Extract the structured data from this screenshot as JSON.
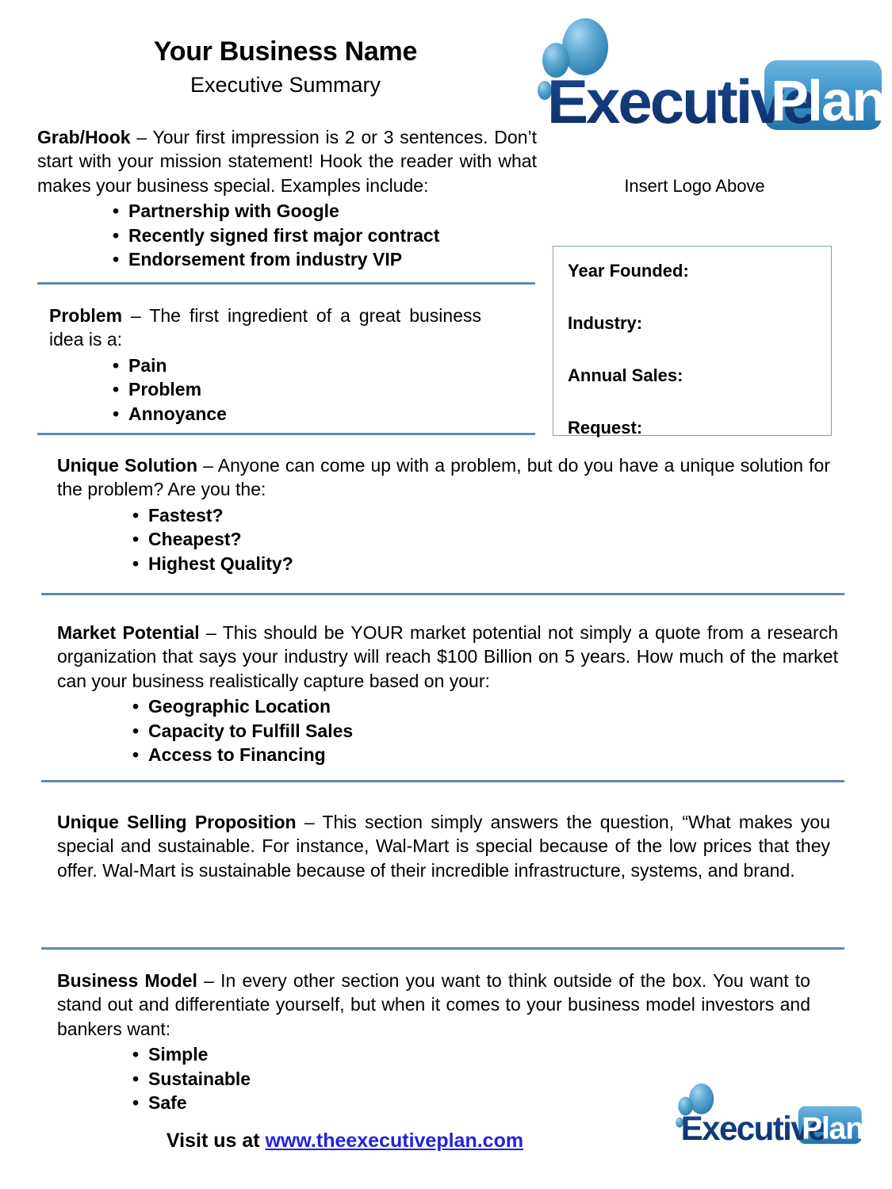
{
  "document": {
    "title": "Your Business Name",
    "subtitle": "Executive Summary"
  },
  "logo": {
    "word_dark": "Executive",
    "word_light": "Plan",
    "caption": "Insert Logo Above",
    "colors": {
      "dark_navy": "#123A7A",
      "badge_top": "#5CA8D8",
      "badge_bottom": "#2B7AB8",
      "bubble": "#479BCB"
    }
  },
  "info_box": {
    "fields": [
      "Year Founded:",
      "Industry:",
      "Annual Sales:",
      "Request:"
    ],
    "border_color": "#7F9DB9"
  },
  "rule_color": "#6189B0",
  "sections": {
    "grab_hook": {
      "lead": "Grab/Hook",
      "body": " – Your first impression is 2 or 3 sentences. Don’t start with your mission statement!  Hook the reader with what makes your business special.  Examples include:",
      "bullets": [
        "Partnership with Google",
        "Recently signed first major contract",
        "Endorsement from industry VIP"
      ]
    },
    "problem": {
      "lead": "Problem",
      "body": " – The first ingredient of a great business idea is a:",
      "bullets": [
        "Pain",
        "Problem",
        "Annoyance"
      ]
    },
    "unique_solution": {
      "lead": "Unique Solution",
      "body": " – Anyone can come up with a problem, but do you have a unique solution for the problem?  Are you the:",
      "bullets": [
        "Fastest?",
        "Cheapest?",
        "Highest Quality?"
      ]
    },
    "market_potential": {
      "lead": "Market Potential ",
      "body": " – This should be YOUR market potential not simply a quote from a research organization that says your industry will reach $100 Billion on 5 years.  How much of the market can your business realistically capture based on your:",
      "bullets": [
        "Geographic Location",
        "Capacity to Fulfill Sales",
        "Access to Financing"
      ]
    },
    "unique_selling_proposition": {
      "lead": "Unique Selling Proposition",
      "body": " – This section simply answers the question, “What makes you special and sustainable.  For instance, Wal-Mart is special because of the low prices that they offer.  Wal-Mart is sustainable because of their incredible infrastructure, systems, and brand.",
      "bullets": []
    },
    "business_model": {
      "lead": "Business Model",
      "body": " – In every other section you want to think outside of the box.  You want to stand out and differentiate yourself, but when it comes to your business model investors and bankers want:",
      "bullets": [
        "Simple",
        "Sustainable",
        "Safe"
      ]
    }
  },
  "footer": {
    "prefix": "Visit us at ",
    "url": "www.theexecutiveplan.com",
    "url_color": "#2222DD"
  }
}
